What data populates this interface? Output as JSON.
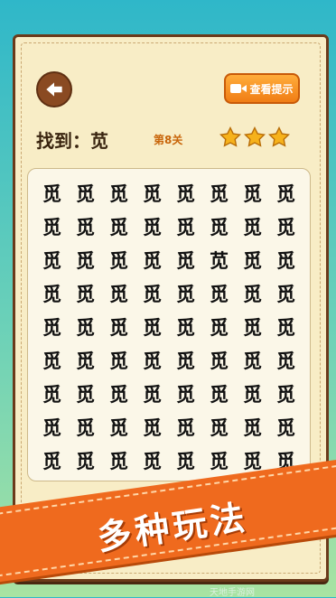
{
  "header": {
    "back_icon": "arrow-left-icon",
    "hint_button_label": "查看提示",
    "hint_icon": "video-camera-icon"
  },
  "puzzle": {
    "find_label": "找到：苋",
    "level_label": "第8关",
    "stars_earned": 3,
    "star_color": "#f6b21b",
    "grid_columns": 8,
    "grid_rows": [
      [
        "觅",
        "觅",
        "觅",
        "觅",
        "觅",
        "觅",
        "觅",
        "觅"
      ],
      [
        "觅",
        "觅",
        "觅",
        "觅",
        "觅",
        "觅",
        "觅",
        "觅"
      ],
      [
        "觅",
        "觅",
        "觅",
        "觅",
        "觅",
        "苋",
        "觅",
        "觅"
      ],
      [
        "觅",
        "觅",
        "觅",
        "觅",
        "觅",
        "觅",
        "觅",
        "觅"
      ],
      [
        "觅",
        "觅",
        "觅",
        "觅",
        "觅",
        "觅",
        "觅",
        "觅"
      ],
      [
        "觅",
        "觅",
        "觅",
        "觅",
        "觅",
        "觅",
        "觅",
        "觅"
      ],
      [
        "觅",
        "觅",
        "觅",
        "觅",
        "觅",
        "觅",
        "觅",
        "觅"
      ],
      [
        "觅",
        "觅",
        "觅",
        "觅",
        "觅",
        "觅",
        "觅",
        "觅"
      ],
      [
        "觅",
        "觅",
        "觅",
        "觅",
        "觅",
        "觅",
        "觅",
        "觅"
      ]
    ]
  },
  "banner": {
    "text": "多种玩法"
  },
  "watermark": "天地手游网"
}
